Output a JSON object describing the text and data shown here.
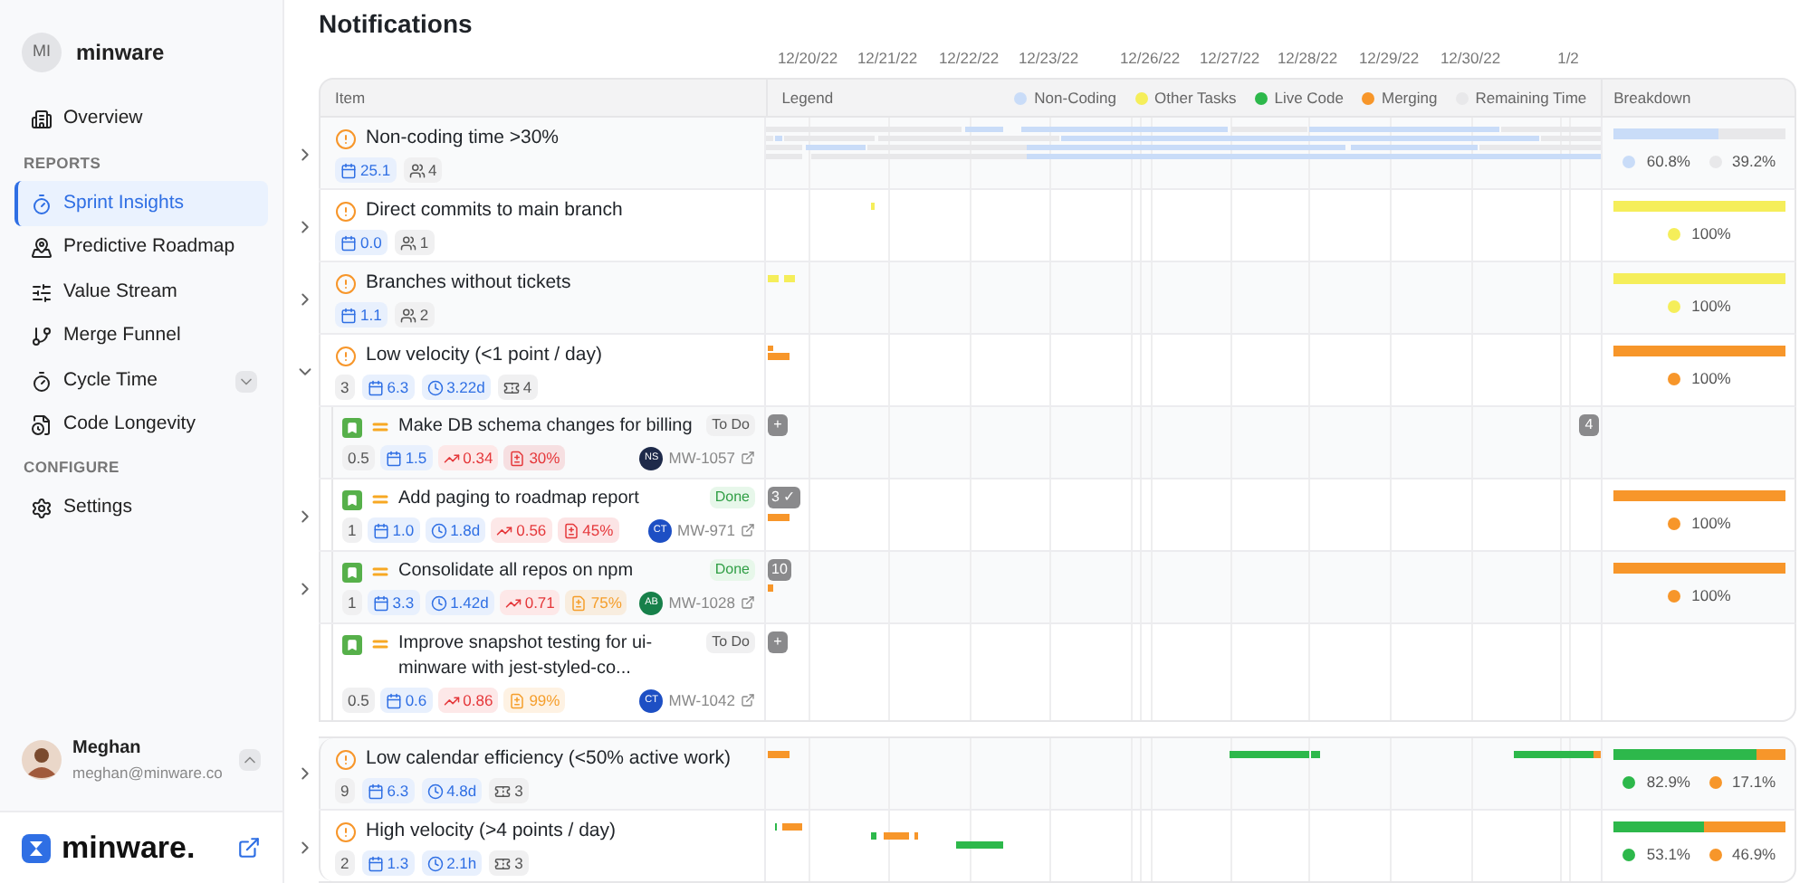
{
  "sidebar": {
    "workspace": {
      "initials": "MI",
      "name": "minware"
    },
    "nav": [
      {
        "kind": "item",
        "label": "Overview",
        "selected": false
      },
      {
        "kind": "section",
        "label": "REPORTS"
      },
      {
        "kind": "item",
        "label": "Sprint Insights",
        "selected": true
      },
      {
        "kind": "item",
        "label": "Predictive Roadmap",
        "selected": false
      },
      {
        "kind": "item",
        "label": "Value Stream",
        "selected": false
      },
      {
        "kind": "item",
        "label": "Merge Funnel",
        "selected": false
      },
      {
        "kind": "menu",
        "label": "Cycle Time",
        "selected": false,
        "expanded": false
      },
      {
        "kind": "item",
        "label": "Code Longevity",
        "selected": false
      },
      {
        "kind": "section",
        "label": "CONFIGURE"
      },
      {
        "kind": "item",
        "label": "Settings",
        "selected": false
      }
    ],
    "user": {
      "name": "Meghan",
      "email": "meghan@minware.co",
      "expanded": true
    },
    "brand": "minware."
  },
  "title": "Notifications",
  "dates": [
    "12/20/22",
    "12/21/22",
    "12/22/22",
    "12/23/22",
    "12/26/22",
    "12/27/22",
    "12/28/22",
    "12/29/22",
    "12/30/22",
    "1/2"
  ],
  "columns": {
    "item": "Item",
    "legend": "Legend",
    "breakdown": "Breakdown"
  },
  "legend": [
    {
      "label": "Non-Coding",
      "color": "#c9dcf8"
    },
    {
      "label": "Other Tasks",
      "color": "#f5ee5a"
    },
    {
      "label": "Live Code",
      "color": "#2db84b"
    },
    {
      "label": "Merging",
      "color": "#f7962a"
    },
    {
      "label": "Remaining Time",
      "color": "#e8e8ea"
    }
  ],
  "sections": [
    {
      "groups": [
        {
          "title": "Non-coding time >30%",
          "expanded": false,
          "stats": [
            {
              "kind": "estimate",
              "text": "25.1"
            },
            {
              "kind": "people",
              "text": "4"
            }
          ],
          "breakdown": [
            {
              "share": "60.8%",
              "color": "#c9dcf8"
            },
            {
              "share": "39.2%",
              "color": "#e8e8ea"
            }
          ]
        },
        {
          "title": "Direct commits to main branch",
          "expanded": false,
          "stats": [
            {
              "kind": "estimate",
              "text": "0.0"
            },
            {
              "kind": "people",
              "text": "1"
            }
          ],
          "breakdown": [
            {
              "share": "100%",
              "color": "#f5ee5a"
            }
          ]
        },
        {
          "title": "Branches without tickets",
          "expanded": false,
          "stats": [
            {
              "kind": "estimate",
              "text": "1.1"
            },
            {
              "kind": "people",
              "text": "2"
            }
          ],
          "breakdown": [
            {
              "share": "100%",
              "color": "#f5ee5a"
            }
          ]
        },
        {
          "title": "Low velocity (<1 point / day)",
          "expanded": true,
          "stats": [
            {
              "kind": "points",
              "text": "3"
            },
            {
              "kind": "estimate",
              "text": "6.3"
            },
            {
              "kind": "time",
              "text": "3.22d"
            },
            {
              "kind": "tickets",
              "text": "4"
            }
          ],
          "breakdown": [
            {
              "share": "100%",
              "color": "#f7962a"
            }
          ],
          "children": [
            {
              "title": "Make DB schema changes for billing",
              "expandable": false,
              "status": {
                "kind": "todo",
                "label": "To Do"
              },
              "stats": [
                {
                  "kind": "points",
                  "text": "0.5"
                },
                {
                  "kind": "estimate",
                  "text": "1.5"
                },
                {
                  "kind": "churn",
                  "text": "0.34"
                },
                {
                  "kind": "rework",
                  "text": "30%",
                  "color": "#e5383b"
                }
              ],
              "assignee": {
                "initials": "NS",
                "color": "#1e2a4a"
              },
              "ticket": "MW-1057",
              "markers": [
                {
                  "label": "+"
                },
                {
                  "label": "4"
                }
              ]
            },
            {
              "title": "Add paging to roadmap report",
              "expandable": true,
              "status": {
                "kind": "done",
                "label": "Done"
              },
              "stats": [
                {
                  "kind": "points",
                  "text": "1"
                },
                {
                  "kind": "estimate",
                  "text": "1.0"
                },
                {
                  "kind": "time",
                  "text": "1.8d"
                },
                {
                  "kind": "churn",
                  "text": "0.56"
                },
                {
                  "kind": "rework",
                  "text": "45%",
                  "color": "#e5383b"
                }
              ],
              "assignee": {
                "initials": "CT",
                "color": "#1d4fc4"
              },
              "ticket": "MW-971",
              "markers": [
                {
                  "label": "3 ✓"
                }
              ],
              "breakdown": [
                {
                  "share": "100%",
                  "color": "#f7962a"
                }
              ]
            },
            {
              "title": "Consolidate all repos on npm",
              "expandable": true,
              "status": {
                "kind": "done",
                "label": "Done"
              },
              "stats": [
                {
                  "kind": "points",
                  "text": "1"
                },
                {
                  "kind": "estimate",
                  "text": "3.3"
                },
                {
                  "kind": "time",
                  "text": "1.42d"
                },
                {
                  "kind": "churn",
                  "text": "0.71"
                },
                {
                  "kind": "rework",
                  "text": "75%",
                  "color": "#f59e2b"
                }
              ],
              "assignee": {
                "initials": "AB",
                "color": "#17804a"
              },
              "ticket": "MW-1028",
              "markers": [
                {
                  "label": "10"
                }
              ],
              "breakdown": [
                {
                  "share": "100%",
                  "color": "#f7962a"
                }
              ]
            },
            {
              "title": "Improve snapshot testing for ui-minware with jest-styled-co...",
              "expandable": false,
              "status": {
                "kind": "todo",
                "label": "To Do"
              },
              "stats": [
                {
                  "kind": "points",
                  "text": "0.5"
                },
                {
                  "kind": "estimate",
                  "text": "0.6"
                },
                {
                  "kind": "churn",
                  "text": "0.86"
                },
                {
                  "kind": "rework",
                  "text": "99%",
                  "color": "#f59e2b"
                }
              ],
              "assignee": {
                "initials": "CT",
                "color": "#1d4fc4"
              },
              "ticket": "MW-1042",
              "markers": [
                {
                  "label": "+"
                }
              ]
            }
          ]
        }
      ]
    },
    {
      "groups": [
        {
          "title": "Low calendar efficiency (<50% active work)",
          "expanded": false,
          "stats": [
            {
              "kind": "points",
              "text": "9"
            },
            {
              "kind": "estimate",
              "text": "6.3"
            },
            {
              "kind": "time",
              "text": "4.8d"
            },
            {
              "kind": "tickets",
              "text": "3"
            }
          ],
          "breakdown": [
            {
              "share": "82.9%",
              "color": "#2db84b"
            },
            {
              "share": "17.1%",
              "color": "#f7962a"
            }
          ]
        },
        {
          "title": "High velocity (>4 points / day)",
          "expanded": false,
          "stats": [
            {
              "kind": "points",
              "text": "2"
            },
            {
              "kind": "estimate",
              "text": "1.3"
            },
            {
              "kind": "time",
              "text": "2.1h"
            },
            {
              "kind": "tickets",
              "text": "3"
            }
          ],
          "breakdown": [
            {
              "share": "53.1%",
              "color": "#2db84b"
            },
            {
              "share": "46.9%",
              "color": "#f7962a"
            }
          ]
        }
      ]
    }
  ]
}
